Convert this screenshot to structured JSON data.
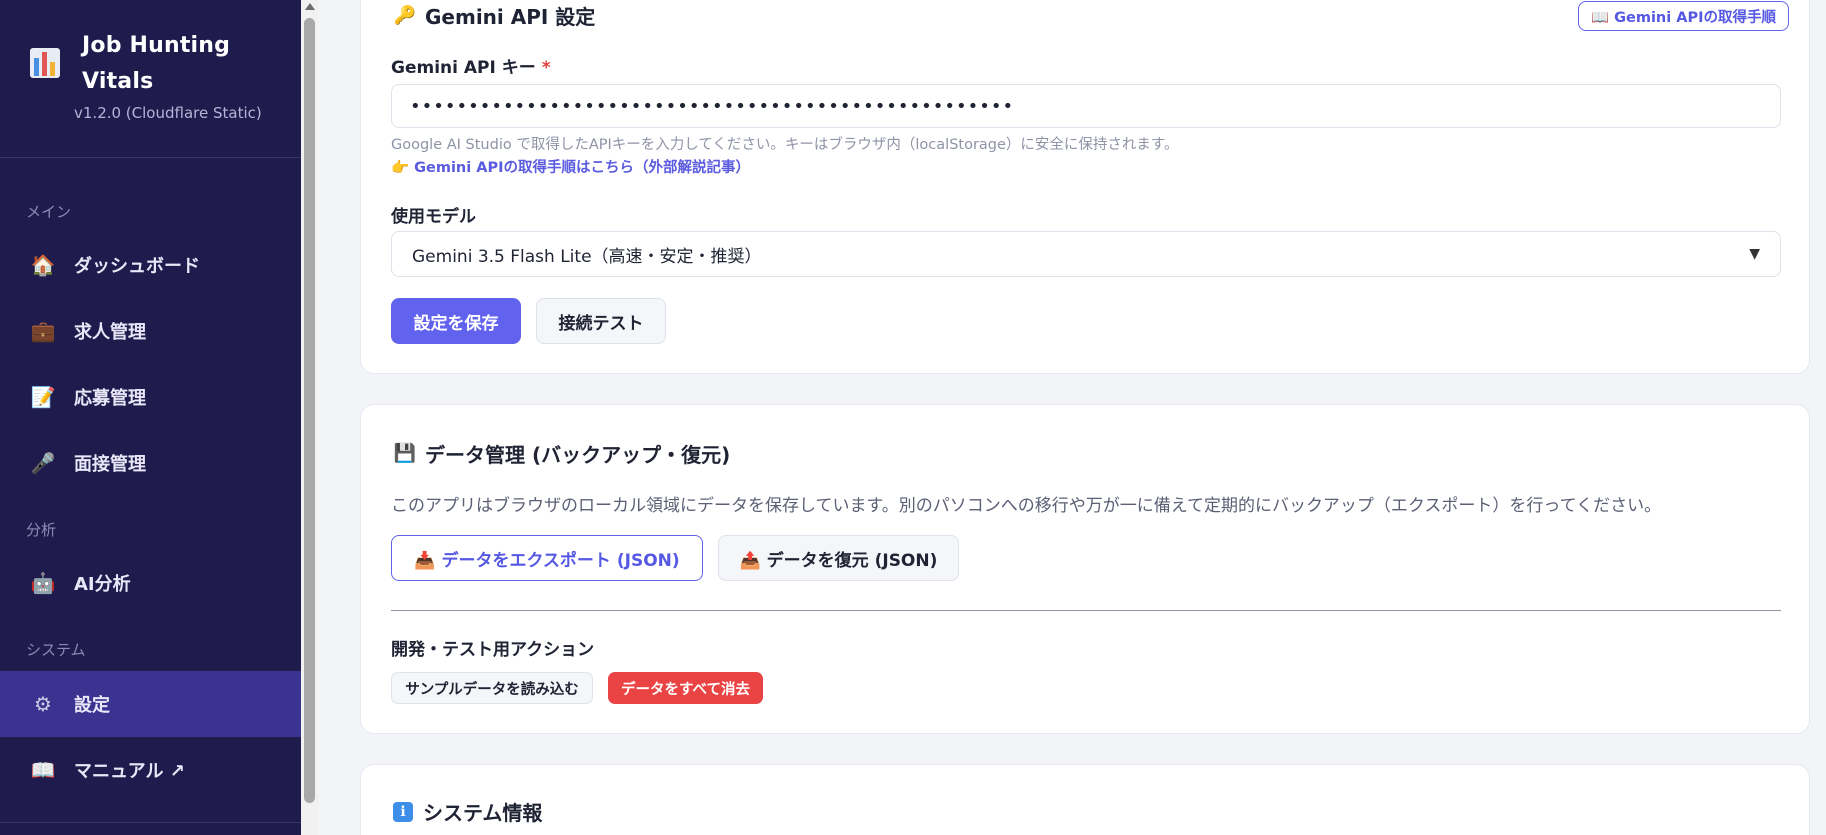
{
  "app": {
    "title": "Job Hunting Vitals",
    "version": "v1.2.0 (Cloudflare Static)"
  },
  "sidebar": {
    "sections": {
      "main": "メイン",
      "analysis": "分析",
      "system": "システム"
    },
    "items": {
      "dashboard": {
        "label": "ダッシュボード",
        "icon": "🏠"
      },
      "jobs": {
        "label": "求人管理",
        "icon": "💼"
      },
      "applications": {
        "label": "応募管理",
        "icon": "📝"
      },
      "interviews": {
        "label": "面接管理",
        "icon": "🎤"
      },
      "ai": {
        "label": "AI分析",
        "icon": "🤖"
      },
      "settings": {
        "label": "設定",
        "icon": "⚙"
      },
      "manual": {
        "label": "マニュアル ↗",
        "icon": "📖"
      }
    }
  },
  "gemini": {
    "title": "Gemini API 設定",
    "title_icon": "🔑",
    "guide_button": "📖 Gemini APIの取得手順",
    "key_label": "Gemini API キー",
    "required_mark": "*",
    "key_value": "••••••••••••••••••••••••••••••••••••••••••••••••••••",
    "help_text": "Google AI Studio で取得したAPIキーを入力してください。キーはブラウザ内（localStorage）に安全に保持されます。",
    "help_link": "👉 Gemini APIの取得手順はこちら（外部解説記事）",
    "model_label": "使用モデル",
    "model_value": "Gemini 3.5 Flash Lite（高速・安定・推奨）",
    "save_button": "設定を保存",
    "test_button": "接続テスト"
  },
  "data_mgmt": {
    "title": "データ管理 (バックアップ・復元)",
    "title_icon": "💾",
    "description": "このアプリはブラウザのローカル領域にデータを保存しています。別のパソコンへの移行や万が一に備えて定期的にバックアップ（エクスポート）を行ってください。",
    "export_button": "📥 データをエクスポート (JSON)",
    "restore_button": "📤 データを復元 (JSON)",
    "dev_title": "開発・テスト用アクション",
    "sample_button": "サンプルデータを読み込む",
    "clear_button": "データをすべて消去"
  },
  "sysinfo": {
    "title": "システム情報",
    "title_icon": "ℹ"
  },
  "colors": {
    "sidebar_bg": "#1f1b4d",
    "sidebar_active": "#3a3390",
    "primary": "#6162ee",
    "danger": "#e94343"
  }
}
